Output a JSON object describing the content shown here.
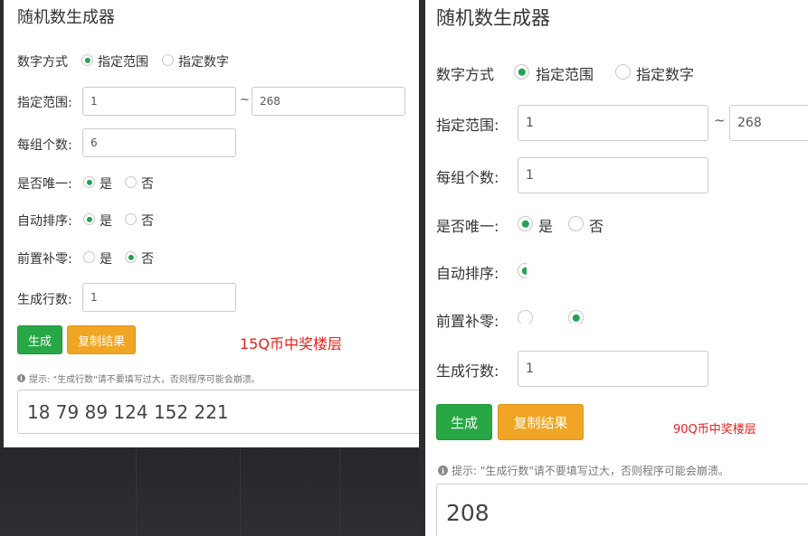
{
  "left": {
    "title": "随机数生成器",
    "mode": {
      "label": "数字方式",
      "options": [
        "指定范围",
        "指定数字"
      ],
      "selected": 0
    },
    "range": {
      "label": "指定范围:",
      "from": "1",
      "separator": "~",
      "to": "268"
    },
    "per_group": {
      "label": "每组个数:",
      "value": "6"
    },
    "unique": {
      "label": "是否唯一:",
      "options": [
        "是",
        "否"
      ],
      "selected": 0
    },
    "sort": {
      "label": "自动排序:",
      "options": [
        "是",
        "否"
      ],
      "selected": 0
    },
    "zero_pad": {
      "label": "前置补零:",
      "options": [
        "是",
        "否"
      ],
      "selected": 1
    },
    "rows": {
      "label": "生成行数:",
      "value": "1"
    },
    "generate_label": "生成",
    "copy_label": "复制结果",
    "note": "15Q币中奖楼层",
    "hint": "提示: \"生成行数\"请不要填写过大，否则程序可能会崩溃。",
    "result": "18 79 89 124 152 221"
  },
  "right": {
    "title": "随机数生成器",
    "mode": {
      "label": "数字方式",
      "options": [
        "指定范围",
        "指定数字"
      ],
      "selected": 0
    },
    "range": {
      "label": "指定范围:",
      "from": "1",
      "separator": "~",
      "to": "268"
    },
    "per_group": {
      "label": "每组个数:",
      "value": "1"
    },
    "unique": {
      "label": "是否唯一:",
      "options": [
        "是",
        "否"
      ],
      "selected": 0
    },
    "sort": {
      "label": "自动排序:"
    },
    "zero_pad": {
      "label": "前置补零:"
    },
    "rows": {
      "label": "生成行数:",
      "value": "1"
    },
    "generate_label": "生成",
    "copy_label": "复制结果",
    "note": "90Q币中奖楼层",
    "hint": "提示: \"生成行数\"请不要填写过大，否则程序可能会崩溃。",
    "result": "208"
  },
  "colors": {
    "accent_green": "#28a745",
    "accent_orange": "#f0a524",
    "note_red": "#e8211a",
    "background_dark": "#2a2c30"
  }
}
